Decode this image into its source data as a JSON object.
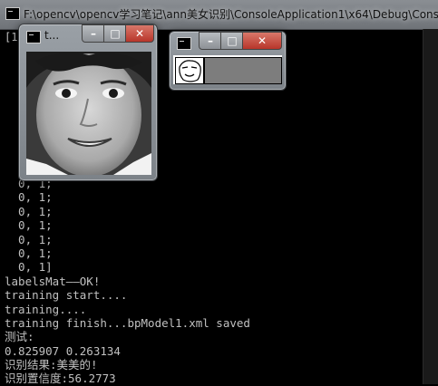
{
  "console": {
    "title": "F:\\opencv\\opencv学习笔记\\ann美女识别\\ConsoleApplication1\\x64\\Debug\\Cons",
    "prompt_stub": "[1",
    "lines": [
      "  0, 1;",
      "  0, 1;",
      "  0, 1;",
      "  0, 1;",
      "  0, 1;",
      "  0, 1;",
      "  0, 1]",
      "labelsMat——OK!",
      "training start....",
      "training....",
      "training finish...bpModel1.xml saved",
      "测试:",
      "0.825907 0.263134",
      "识别结果:美美的!",
      "识别置信度:56.2773"
    ]
  },
  "face_window": {
    "title": "t...",
    "min": "–",
    "max": "□",
    "close": "✕"
  },
  "pred_window": {
    "min": "–",
    "max": "□",
    "close": "✕"
  },
  "colors": {
    "console_bg": "#000000",
    "console_text": "#c0c0c0",
    "aero_frame": "#8a9096",
    "close_red": "#c7463a"
  }
}
